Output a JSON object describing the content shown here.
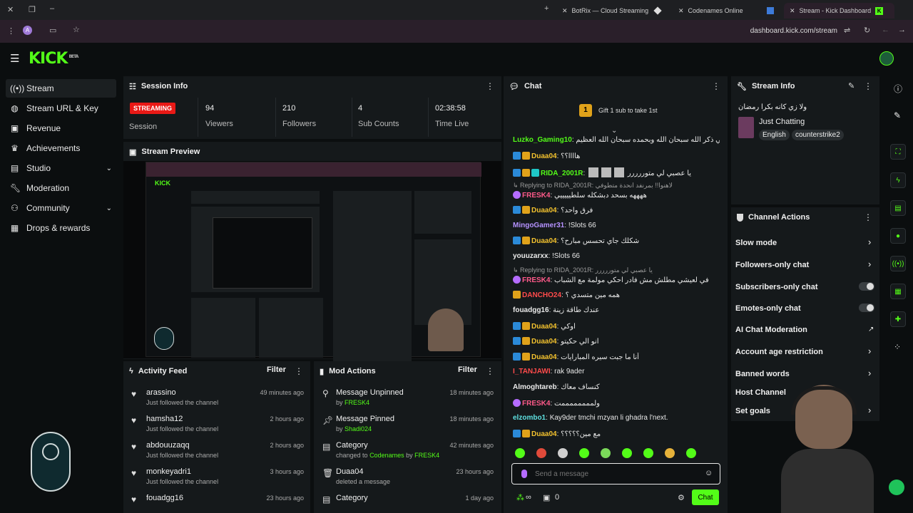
{
  "browser": {
    "tabs": [
      {
        "label": "BotRix — Cloud Streaming Bot"
      },
      {
        "label": "Codenames Online"
      },
      {
        "label": "Stream - Kick Dashboard"
      }
    ],
    "url": "dashboard.kick.com/stream"
  },
  "brand": {
    "logo": "KICK",
    "tag": "BETA",
    "accent": "#53fc18"
  },
  "sidebar": {
    "items": [
      {
        "label": "Stream",
        "icon": "signal-icon"
      },
      {
        "label": "Stream URL & Key",
        "icon": "globe-icon"
      },
      {
        "label": "Revenue",
        "icon": "dollar-icon"
      },
      {
        "label": "Achievements",
        "icon": "trophy-icon"
      },
      {
        "label": "Studio",
        "icon": "studio-icon"
      },
      {
        "label": "Moderation",
        "icon": "wrench-icon"
      },
      {
        "label": "Community",
        "icon": "community-icon"
      },
      {
        "label": "Drops & rewards",
        "icon": "gift-icon"
      }
    ]
  },
  "session": {
    "title": "Session Info",
    "badge": "STREAMING",
    "session_label": "Session",
    "stats": [
      {
        "value": "94",
        "label": "Viewers"
      },
      {
        "value": "210",
        "label": "Followers"
      },
      {
        "value": "4",
        "label": "Sub Counts"
      },
      {
        "value": "02:38:58",
        "label": "Time Live"
      }
    ]
  },
  "preview": {
    "title": "Stream Preview"
  },
  "activity": {
    "title": "Activity Feed",
    "filter": "Filter",
    "items": [
      {
        "name": "arassino",
        "sub": "Just followed the channel",
        "time": "49 minutes ago"
      },
      {
        "name": "hamsha12",
        "sub": "Just followed the channel",
        "time": "2 hours ago"
      },
      {
        "name": "abdouuzaqq",
        "sub": "Just followed the channel",
        "time": "2 hours ago"
      },
      {
        "name": "monkeyadri1",
        "sub": "Just followed the channel",
        "time": "3 hours ago"
      },
      {
        "name": "fouadgg16",
        "sub": "",
        "time": "23 hours ago"
      }
    ]
  },
  "mod_actions": {
    "title": "Mod Actions",
    "filter": "Filter",
    "items": [
      {
        "name": "Message Unpinned",
        "pre": "by",
        "who": "FRESK4",
        "time": "18 minutes ago"
      },
      {
        "name": "Message Pinned",
        "pre": "by",
        "who": "Shadi024",
        "time": "18 minutes ago"
      },
      {
        "name": "Category",
        "pre": "changed to",
        "who": "Codenames",
        "mid": "by",
        "who2": "FRESK4",
        "time": "42 minutes ago"
      },
      {
        "name": "Duaa04",
        "pre": "deleted a message",
        "who": "",
        "time": "23 hours ago"
      },
      {
        "name": "Category",
        "pre": "",
        "who": "",
        "time": "1 day ago"
      }
    ]
  },
  "chat": {
    "title": "Chat",
    "gift_text": "Gift 1 sub to take 1st",
    "gift_rank": "1",
    "messages": [
      {
        "user": "Luzko_Gaming10",
        "text": "نسي ذكر الله سبحان الله وبحمده سبحان الله العظيم"
      },
      {
        "user": "Duaa04",
        "text": "هاااا؟؟"
      },
      {
        "user": "RIDA_2001R",
        "text": "يا عصبي لي متوررررر"
      },
      {
        "reply": "Replying to RIDA_2001R: لاهنوا!! بمرنفد انحدة متطوفي"
      },
      {
        "user": "FRESK4",
        "text": "ههههه بسحد دبشكله سلطيييييي"
      },
      {
        "user": "Duaa04",
        "text": "فرق واحد؟"
      },
      {
        "user": "MingoGamer31",
        "text": "!Slots 66"
      },
      {
        "user": "Duaa04",
        "text": "شكلك جاي تحسس مبارح؟"
      },
      {
        "user": "youuzarxx",
        "text": "!Slots 66"
      },
      {
        "reply": "Replying to RIDA_2001R: يا عصبي لي متوررررر"
      },
      {
        "user": "FRESK4",
        "text": "في لعيشي مطلش مش فادر احكي مولمة مع الشباب"
      },
      {
        "user": "DANCHO24",
        "text": "همه مين متسدي ؟"
      },
      {
        "user": "fouadgg16",
        "text": "عندك طاقة زينة"
      },
      {
        "user": "Duaa04",
        "text": "اوكي"
      },
      {
        "user": "Duaa04",
        "text": "انو الي حكيتو"
      },
      {
        "user": "Duaa04",
        "text": "أنا ما جبت سيره المبارايات"
      },
      {
        "user": "I_TANJAWI",
        "text": "rak 9ader"
      },
      {
        "user": "Almoghtareb",
        "text": "كنساف معاك"
      },
      {
        "user": "FRESK4",
        "text": "ولممممممممت"
      },
      {
        "user": "elzombo1",
        "text": "Kay9der tmchi mzyan li ghadra l'next."
      },
      {
        "user": "Duaa04",
        "text": "مع مين؟؟؟؟؟"
      }
    ],
    "input_placeholder": "Send a message",
    "viewer_count": "0",
    "infinity": "∞",
    "send_label": "Chat"
  },
  "stream_info": {
    "title": "Stream Info",
    "stream_title": "ولا زي كانه بكرا رمضان",
    "category": "Just Chatting",
    "tags": [
      "English",
      "counterstrike2"
    ]
  },
  "channel_actions": {
    "title": "Channel Actions",
    "items": [
      {
        "label": "Slow mode",
        "control": "arrow"
      },
      {
        "label": "Followers-only chat",
        "control": "arrow"
      },
      {
        "label": "Subscribers-only chat",
        "control": "toggle"
      },
      {
        "label": "Emotes-only chat",
        "control": "toggle"
      },
      {
        "label": "AI Chat Moderation",
        "control": "external"
      },
      {
        "label": "Account age restriction",
        "control": "arrow"
      },
      {
        "label": "Banned words",
        "control": "arrow"
      },
      {
        "label": "Host Channel",
        "control": "none"
      },
      {
        "label": "Set goals",
        "control": "arrow"
      }
    ]
  }
}
